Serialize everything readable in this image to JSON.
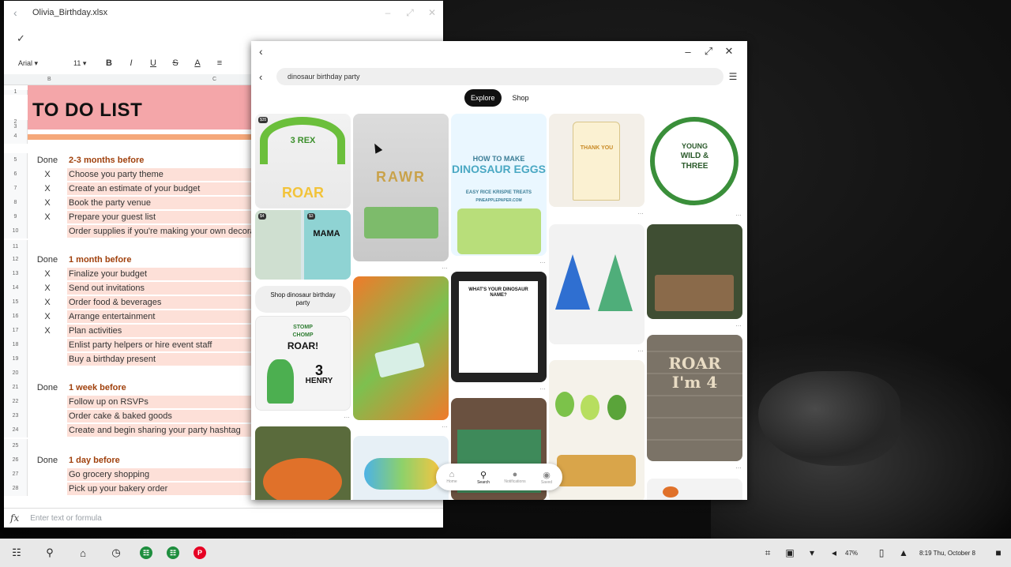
{
  "sheets": {
    "filename": "Olivia_Birthday.xlsx",
    "font": "Arial",
    "font_size": "11",
    "formula_placeholder": "Enter text or formula",
    "col_b": "B",
    "col_c": "C",
    "title": "TO DO LIST",
    "rows": [
      {
        "n": "1",
        "status": "",
        "text": ""
      },
      {
        "n": "2",
        "status": "",
        "text": ""
      },
      {
        "n": "3",
        "status": "",
        "text": ""
      },
      {
        "n": "4",
        "status": "",
        "text": ""
      },
      {
        "n": "5",
        "status": "Done",
        "text": "2-3 months before",
        "kind": "section"
      },
      {
        "n": "6",
        "status": "X",
        "text": "Choose you party theme",
        "kind": "task"
      },
      {
        "n": "7",
        "status": "X",
        "text": "Create an estimate of your budget",
        "kind": "task"
      },
      {
        "n": "8",
        "status": "X",
        "text": "Book the party venue",
        "kind": "task"
      },
      {
        "n": "9",
        "status": "X",
        "text": "Prepare your guest list",
        "kind": "task"
      },
      {
        "n": "10",
        "status": "",
        "text": "Order supplies if you're making your own decoratio",
        "kind": "task"
      },
      {
        "n": "11",
        "status": "",
        "text": ""
      },
      {
        "n": "12",
        "status": "Done",
        "text": "1 month before",
        "kind": "section"
      },
      {
        "n": "13",
        "status": "X",
        "text": "Finalize your budget",
        "kind": "task"
      },
      {
        "n": "14",
        "status": "X",
        "text": "Send out invitations",
        "kind": "task"
      },
      {
        "n": "15",
        "status": "X",
        "text": "Order food & beverages",
        "kind": "task"
      },
      {
        "n": "16",
        "status": "X",
        "text": "Arrange entertainment",
        "kind": "task"
      },
      {
        "n": "17",
        "status": "X",
        "text": "Plan activities",
        "kind": "task"
      },
      {
        "n": "18",
        "status": "",
        "text": "Enlist party helpers or hire event staff",
        "kind": "task"
      },
      {
        "n": "19",
        "status": "",
        "text": "Buy a birthday present",
        "kind": "task"
      },
      {
        "n": "20",
        "status": "",
        "text": ""
      },
      {
        "n": "21",
        "status": "Done",
        "text": "1 week before",
        "kind": "section"
      },
      {
        "n": "22",
        "status": "",
        "text": "Follow up on RSVPs",
        "kind": "task"
      },
      {
        "n": "23",
        "status": "",
        "text": "Order cake & baked goods",
        "kind": "task"
      },
      {
        "n": "24",
        "status": "",
        "text": "Create and begin sharing your party hashtag",
        "kind": "task"
      },
      {
        "n": "25",
        "status": "",
        "text": ""
      },
      {
        "n": "26",
        "status": "Done",
        "text": "1 day before",
        "kind": "section"
      },
      {
        "n": "27",
        "status": "",
        "text": "Go grocery shopping",
        "kind": "task"
      },
      {
        "n": "28",
        "status": "",
        "text": "Pick up your bakery order",
        "kind": "task"
      }
    ]
  },
  "pinterest": {
    "search_query": "dinosaur birthday party",
    "tabs": [
      "Explore",
      "Shop"
    ],
    "shop_button": "Shop dinosaur birthday party",
    "pins": {
      "rex": "3 REX",
      "roar": "ROAR",
      "mama": "MAMA",
      "price1": "$35",
      "price2": "$4",
      "price3": "$3",
      "rawr": "RAWR",
      "eggs_line1": "HOW TO MAKE",
      "eggs_line2": "DINOSAUR EGGS",
      "eggs_line3": "EASY RICE KRISPIE TREATS",
      "eggs_source": "PINEAPPLEPAPER.COM",
      "tag_text": "THANK YOU",
      "wild_line1": "YOUNG",
      "wild_line2": "WILD &",
      "wild_line3": "THREE",
      "invite_line1": "STOMP",
      "invite_line2": "CHOMP",
      "invite_line3": "ROAR!",
      "invite_name": "HENRY",
      "invite_age": "3",
      "dino_name_title": "WHAT'S YOUR DINOSAUR NAME?",
      "topper_line1": "ROAR",
      "topper_line2": "I'm 4"
    },
    "nav": [
      "Home",
      "Search",
      "Notifications",
      "Saved"
    ]
  },
  "shelf": {
    "battery": "47%",
    "time": "8:19 Thu, October 8"
  },
  "colors": {
    "title_band": "#f4a6a9",
    "section_text": "#a0410d",
    "task_bg": "#fde0d8",
    "sheets_icon": "#1e8e3e",
    "pinterest_icon": "#e60023"
  },
  "icons": {
    "launcher": "launcher-icon",
    "search": "search-icon",
    "home": "home-icon",
    "history": "history-icon"
  }
}
